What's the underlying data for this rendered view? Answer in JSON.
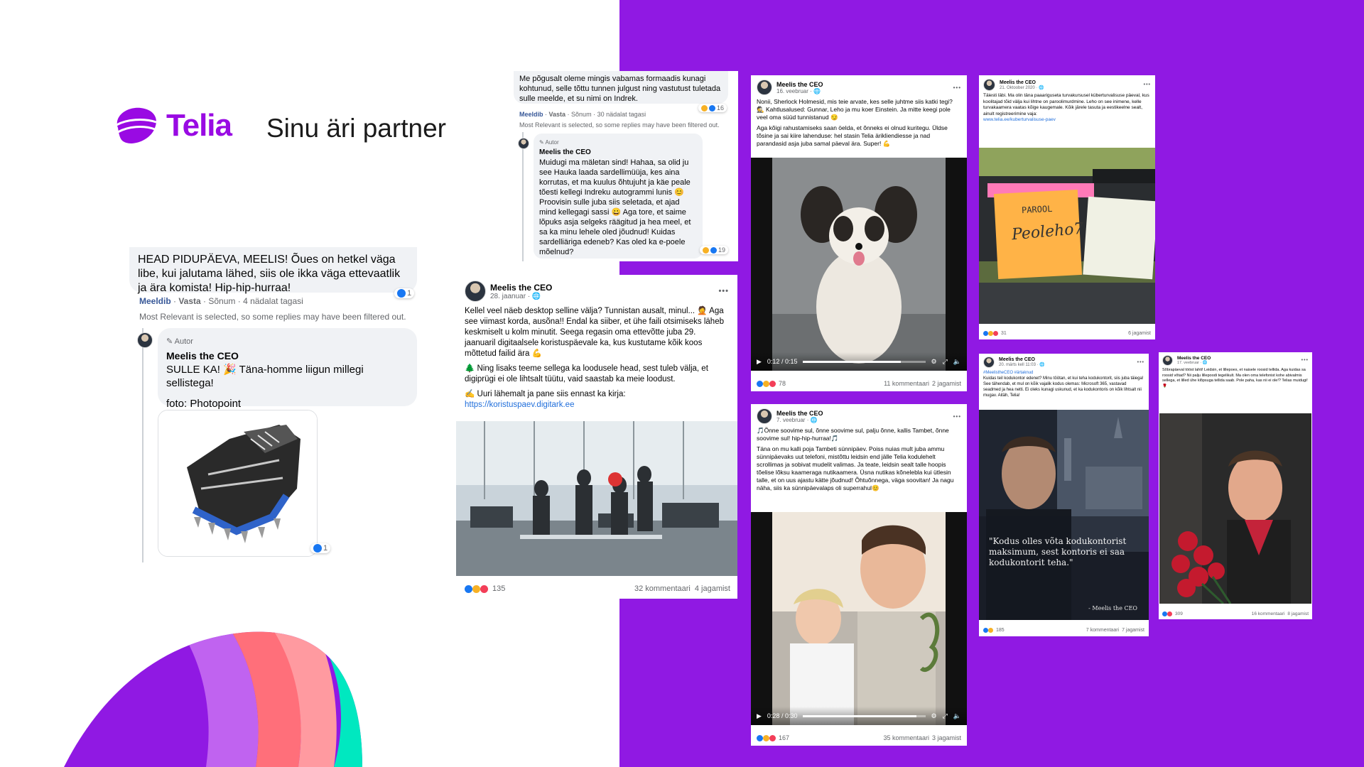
{
  "brand": {
    "name": "Telia",
    "tagline": "Sinu äri partner",
    "accent": "#990ae3",
    "background_purple": "#9019e3"
  },
  "comment_thread": {
    "top_comment": "HEAD PIDUPÄEVA, MEELIS! Õues on hetkel väga libe, kui jalutama lähed, siis ole ikka väga ettevaatlik ja ära komista! Hip-hip-hurraa!",
    "top_reactions": "1",
    "actions": {
      "like": "Meeldib",
      "reply": "Vasta",
      "message": "Sõnum",
      "time": "4 nädalat tagasi"
    },
    "filter_note": "Most Relevant is selected, so some replies may have been filtered out.",
    "reply": {
      "author_tag": "Autor",
      "author": "Meelis the CEO",
      "text": "SULLE KA! 🎉 Täna-homme liigun millegi sellistega!",
      "photo_credit": "foto: Photopoint",
      "image_reactions": "1"
    }
  },
  "comment_thread_2": {
    "top_comment": "Me põgusalt oleme mingis vabamas formaadis kunagi kohtunud, selle tõttu tunnen julgust ning vastutust tuletada sulle meelde, et su nimi on Indrek.",
    "top_reactions": "16",
    "actions": {
      "like": "Meeldib",
      "reply": "Vasta",
      "message": "Sõnum",
      "time": "30 nädalat tagasi"
    },
    "filter_note": "Most Relevant is selected, so some replies may have been filtered out.",
    "reply": {
      "author_tag": "Autor",
      "author": "Meelis the CEO",
      "text": "Muidugi ma mäletan sind! Hahaa, sa olid ju see Hauka laada sardellimüüja, kes aina korrutas, et ma kuulus õhtujuht ja käe peale tõesti kellegi Indreku autogrammi lunis 😊 Proovisin sulle juba siis seletada, et ajad mind kellegagi sassi 😀 Aga tore, et saime lõpuks asja selgeks räägitud ja hea meel, et sa ka minu lehele oled jõudnud! Kuidas sardelliäriga edeneb? Kas oled ka e-poele mõelnud?",
      "reactions": "19"
    }
  },
  "post_main": {
    "author": "Meelis the CEO",
    "date": "28. jaanuar",
    "more": "•••",
    "p1": "Kellel veel näeb desktop selline välja? Tunnistan ausalt, minul... 🤦 Aga see viimast korda, ausõna!! Endal ka siiber, et ühe faili otsimiseks läheb keskmiselt u kolm minutit. Seega regasin oma ettevõtte juba 29. jaanuaril digitaalsele koristuspäevale ka, kus kustutame kõik koos mõttetud failid ära 💪",
    "p2": "🌲 Ning lisaks teeme sellega ka loodusele head, sest tuleb välja, et digiprügi ei ole lihtsalt tüütu, vaid saastab ka meie loodust.",
    "p3": "✍️ Uuri lähemalt ja pane siis ennast ka kirja:",
    "link": "https://koristuspaev.digitark.ee",
    "reactions": "135",
    "comments": "32 kommentaari",
    "shares": "4 jagamist"
  },
  "post_dog": {
    "author": "Meelis the CEO",
    "date": "16. veebruar",
    "more": "•••",
    "p1": "Nonii, Sherlock Holmesid, mis teie arvate, kes selle juhtme siis katki tegi? 🕵️ Kahtlusalused: Gunnar, Leho ja mu koer Einstein. Ja mitte keegi pole veel oma süüd tunnistanud 😏",
    "p2": "Aga kõigi rahustamiseks saan öelda, et õnneks ei olnud kuritegu. Üldse tõsine ja sai kiire lahenduse: hel stasin Telia ärikliendiesse ja nad parandasid asja juba samal päeval ära. Super! 💪",
    "time": "0:12 / 0:15",
    "reactions": "78",
    "comments": "11 kommentaari",
    "shares": "2 jagamist"
  },
  "post_son": {
    "author": "Meelis the CEO",
    "date": "7. veebruar",
    "more": "•••",
    "p1": "🎵Õnne soovime sul, õnne soovime sul, palju õnne, kallis Tambet, õnne soovime sul! hip-hip-hurraa!🎵",
    "p2": "Täna on mu kalli poja Tambeti sünnipäev. Poiss nuias mult juba ammu sünnipäevaks uut telefoni, mistõttu leidsin end jälle Telia kodulehelt scrollimas ja sobivat mudelit valimas. Ja teate, leidsin sealt talle hoopis tõelise lõksu kaameraga nutikaamera. Üsna nutikas kõnelebla kui ütlesin talle, et on uus ajastu kätte jõudnud! Õhtuõnnega, väga soovitan! Ja nagu näha, siis ka sünnipäevalaps oli superrahul😊",
    "time": "0:28 / 0:30",
    "reactions": "167",
    "comments": "35 kommentaari",
    "shares": "3 jagamist"
  },
  "post_password": {
    "author": "Meelis the CEO",
    "date": "21. Oktoober 2020",
    "more": "•••",
    "text": "Täiesti läbi. Ma olin täna paaariguseta turvakursusel küberturvalisuse päeval, kus koolitajad tõid välja kui lihtne on paroolimurdmine. Leho on see inimene, kelle turvakaamera vaatas kõige kaugemale. Kõik järele tasuta ja eestikeelne sealt, ainult registreerimine vaja:",
    "link": "www.telia.ee/kuberturvalisuse-paev",
    "note_label": "PAROOL",
    "note_text": "Peoleho7",
    "reactions": "31",
    "shares": "6 jagamist"
  },
  "post_portrait": {
    "author": "Meelis the CEO",
    "date": "20. märts kell 11:03",
    "more": "•••",
    "hashtag": "#MeelistheCEO #ärtaknud",
    "text": "Kuidas teil kodukontor edenet? Minu töötan, et kui teha kodukontorit, siis juba täiega! See tähendab, et mul on kõik vajalik kodus olemas: Microsoft 365, vastavad seadmed ja hea netti. Ei oleks kunagi uskunud, et ka kodukontoris on kõik lihtsalt nii mugav. Aitäh, Telia!",
    "quote": "\"Kodus olles võta kodukontorist maksimum, sest kontoris ei saa kodukontorit teha.\"",
    "quote_author": "- Meelis the CEO",
    "reactions": "185",
    "comments": "7 kommentaari",
    "shares": "7 jagamist"
  },
  "post_roses": {
    "author": "Meelis the CEO",
    "date": "17. veebruar",
    "more": "•••",
    "text": "Sõbrapäeval tööst lahti! Leidsin, et lillepoes, et naisele roosid tellida. Aga kuidas sa roosid võtad? Nii palju lillepoodi tegelikult. Ma olen oma telefonist kohe abivalmis sellega, et lilled ühe klõpsuga tellida saab. Pole paha, kas nii ei ole!? Telias muidugi! 🌹",
    "reactions": "309",
    "comments": "16 kommentaari",
    "shares": "8 jagamist"
  }
}
